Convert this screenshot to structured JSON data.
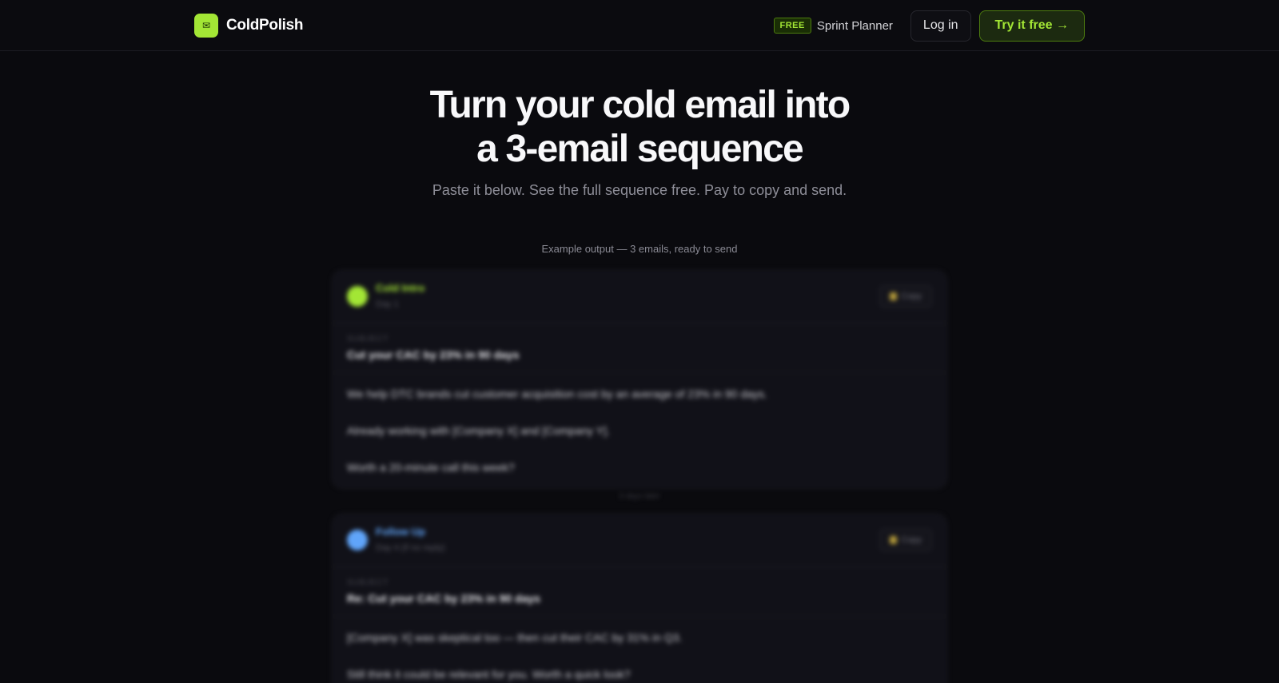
{
  "header": {
    "brand_name": "ColdPolish",
    "brand_icon": "envelope-icon",
    "free_badge": "FREE",
    "sprint_link": "Sprint Planner",
    "login_label": "Log in",
    "try_label": "Try it free →"
  },
  "hero": {
    "title_line1": "Turn your cold email into",
    "title_line2": "a 3-email sequence",
    "subtitle": "Paste it below. See the full sequence free. Pay to copy and send."
  },
  "example": {
    "label": "Example output — 3 emails, ready to send"
  },
  "emails": [
    {
      "type": "Cold Intro",
      "day": "Day 1",
      "copy_label": "Copy",
      "subject_label": "SUBJECT",
      "subject": "Cut your CAC by 23% in 90 days",
      "body": [
        "We help DTC brands cut customer acquisition cost by an average of 23% in 90 days.",
        "Already working with [Company X] and [Company Y].",
        "Worth a 20-minute call this week?"
      ],
      "color": "#a3e635"
    },
    {
      "type": "Follow Up",
      "day": "Day 4 (if no reply)",
      "copy_label": "Copy",
      "subject_label": "SUBJECT",
      "subject": "Re: Cut your CAC by 23% in 90 days",
      "body": [
        "[Company X] was skeptical too — then cut their CAC by 31% in Q3.",
        "Still think it could be relevant for you. Worth a quick look?"
      ],
      "color": "#60a5fa"
    }
  ],
  "between_label": "3 days later",
  "colors": {
    "accent": "#a3e635",
    "background": "#0a0a0e",
    "follow_up": "#60a5fa"
  }
}
